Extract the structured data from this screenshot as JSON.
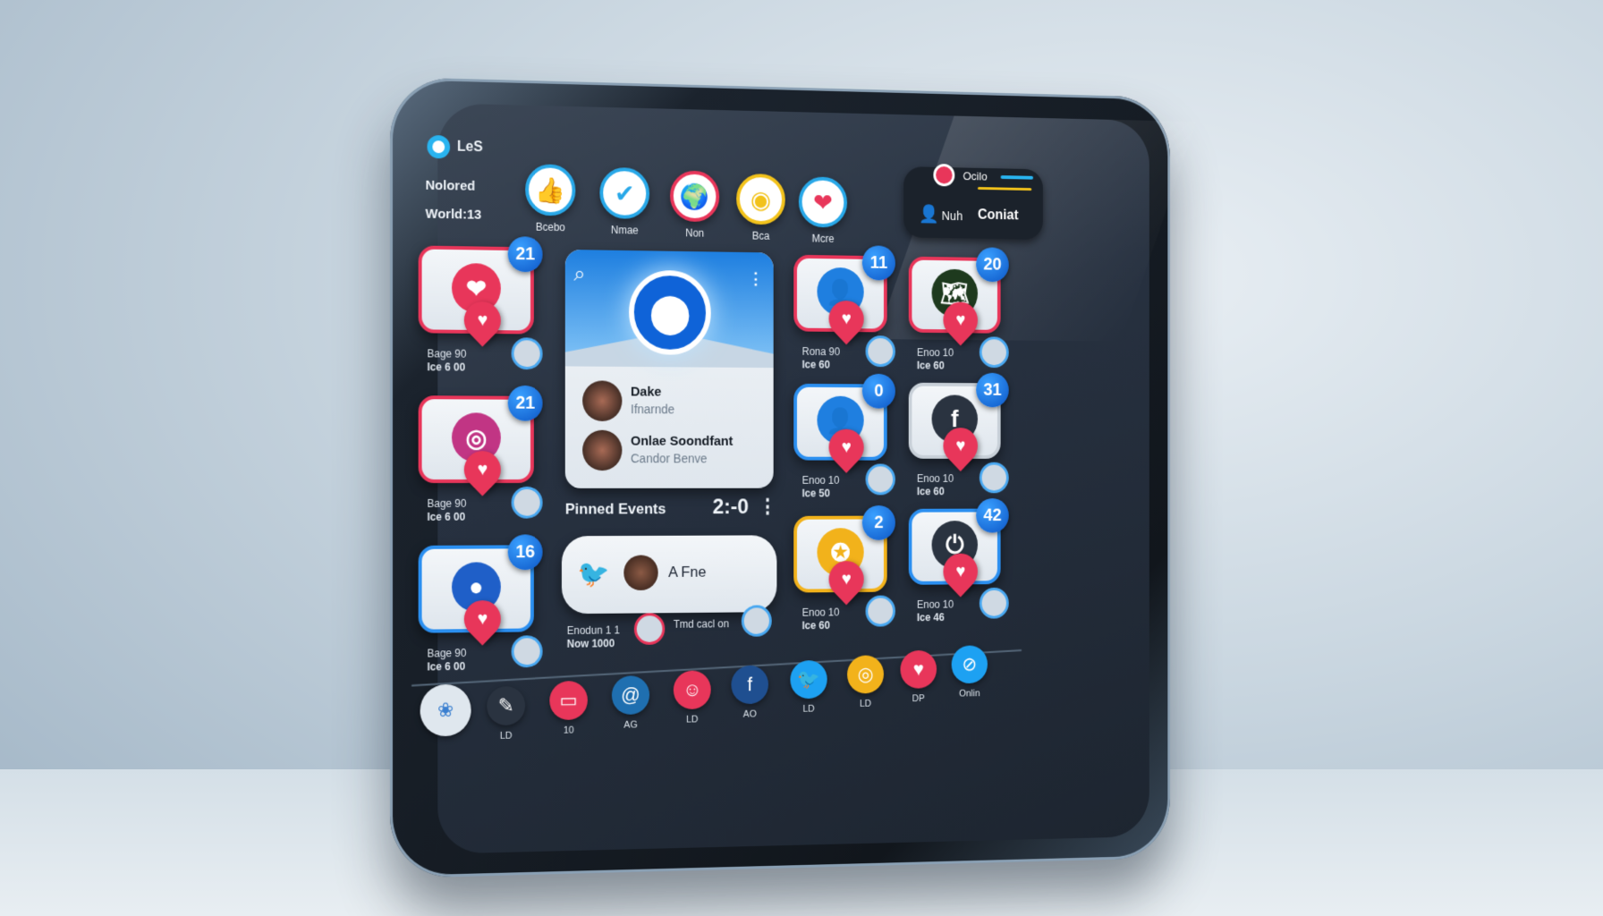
{
  "header": {
    "app_name": "LeS",
    "line1": "Nolored",
    "line2": "World:13"
  },
  "reactions": [
    {
      "label": "Bcebo",
      "icon": "thumbs-up-icon",
      "glyph": "👍",
      "ring": "#29a8e8"
    },
    {
      "label": "Nmae",
      "icon": "check-icon",
      "glyph": "✔",
      "ring": "#29a8e8"
    },
    {
      "label": "Non",
      "icon": "globe-icon",
      "glyph": "🌍",
      "ring": "#e8365a"
    },
    {
      "label": "Bca",
      "icon": "camera-icon",
      "glyph": "◉",
      "ring": "#f2c21b"
    },
    {
      "label": "Mcre",
      "icon": "heart-icon",
      "glyph": "❤",
      "ring": "#29a8e8"
    }
  ],
  "top_right": {
    "title": "Ocilo",
    "user": "Nuh",
    "action": "Coniat"
  },
  "left_cards": [
    {
      "badge": "21",
      "icon": "heart-icon",
      "caption1": "Bage 90",
      "caption2": "Ice 6 00",
      "border": "#e8365a"
    },
    {
      "badge": "21",
      "icon": "instagram-icon",
      "caption1": "Bage 90",
      "caption2": "Ice 6 00",
      "border": "#e8365a"
    },
    {
      "badge": "16",
      "icon": "chat-icon",
      "caption1": "Bage 90",
      "caption2": "Ice 6 00",
      "border": "#2b8ff0"
    }
  ],
  "center_card": {
    "contacts": [
      {
        "name": "Dake",
        "sub": "Ifnarnde"
      },
      {
        "name": "Onlae Soondfant",
        "sub": "Candor Benve"
      }
    ]
  },
  "pinned": {
    "title": "Pinned Events",
    "time": "2:-0",
    "message": "A Fne",
    "caption_left1": "Enodun 1 1",
    "caption_left2": "Now 1000",
    "caption_right": "Tmd cacl on"
  },
  "right_cards": [
    {
      "badge": "11",
      "icon": "user-icon",
      "caption1": "Rona 90",
      "caption2": "Ice 60",
      "border": "#e8365a"
    },
    {
      "badge": "20",
      "icon": "map-icon",
      "caption1": "Enoo 10",
      "caption2": "Ice 60",
      "border": "#e8365a"
    },
    {
      "badge": "0",
      "icon": "user-icon",
      "caption1": "Enoo 10",
      "caption2": "Ice 50",
      "border": "#2b8ff0"
    },
    {
      "badge": "31",
      "icon": "facebook-icon",
      "caption1": "Enoo 10",
      "caption2": "Ice 60",
      "border": "#c8d0d8"
    },
    {
      "badge": "2",
      "icon": "award-icon",
      "caption1": "Enoo 10",
      "caption2": "Ice 60",
      "border": "#f2b21b"
    },
    {
      "badge": "42",
      "icon": "power-icon",
      "caption1": "Enoo 10",
      "caption2": "Ice 46",
      "border": "#2b8ff0"
    }
  ],
  "dock": [
    {
      "label": "",
      "icon": "home-icon",
      "glyph": "❀",
      "color": "#dfe7ee"
    },
    {
      "label": "LD",
      "icon": "pen-icon",
      "glyph": "✎",
      "color": "#2a3340"
    },
    {
      "label": "10",
      "icon": "message-icon",
      "glyph": "▭",
      "color": "#e8365a"
    },
    {
      "label": "AG",
      "icon": "at-icon",
      "glyph": "@",
      "color": "#1f6fb0"
    },
    {
      "label": "LD",
      "icon": "emoji-icon",
      "glyph": "☺",
      "color": "#e8365a"
    },
    {
      "label": "AO",
      "icon": "facebook-icon",
      "glyph": "f",
      "color": "#1f4f90"
    },
    {
      "label": "LD",
      "icon": "twitter-icon",
      "glyph": "🐦",
      "color": "#1da1f2"
    },
    {
      "label": "LD",
      "icon": "ring-icon",
      "glyph": "◎",
      "color": "#f2b21b"
    },
    {
      "label": "DP",
      "icon": "bird-icon",
      "glyph": "♥",
      "color": "#e8365a"
    },
    {
      "label": "Onlin",
      "icon": "compass-icon",
      "glyph": "⊘",
      "color": "#1da1f2"
    }
  ]
}
